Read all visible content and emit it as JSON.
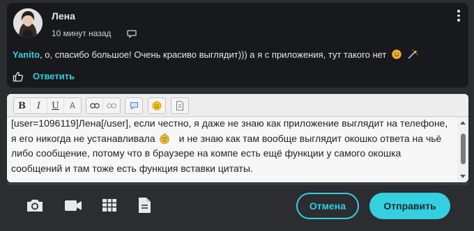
{
  "comment": {
    "author": "Лена",
    "time": "10 минут назад",
    "mention": "Yanito",
    "text": ", о, спасибо большое! Очень красиво выглядит))) а я с приложения, тут такого нет",
    "reply_label": "Ответить"
  },
  "editor": {
    "toolbar": {
      "bold": "B",
      "italic": "I",
      "underline": "U",
      "clear_format": "A"
    },
    "lines": [
      "[user=1096119]Лена[/user], если честно, я даже не знаю как приложение выглядит на телефоне,",
      "я его никогда не устанавливала",
      "и не знаю как там вообще выглядит окошко ответа на чьё",
      "либо сообщение, потому что в браузере на компе есть ещё функции у самого окошка",
      "сообщений и там тоже есть функция вставки цитаты."
    ]
  },
  "actions": {
    "cancel_label": "Отмена",
    "send_label": "Отправить"
  },
  "colors": {
    "accent": "#35d0e0",
    "background": "#2b2d31",
    "card": "#17191c"
  },
  "icons": [
    "reply-bubble-icon",
    "more-dots-icon",
    "like-icon",
    "camera-icon",
    "video-icon",
    "table-icon",
    "document-icon",
    "emoji-icon"
  ]
}
